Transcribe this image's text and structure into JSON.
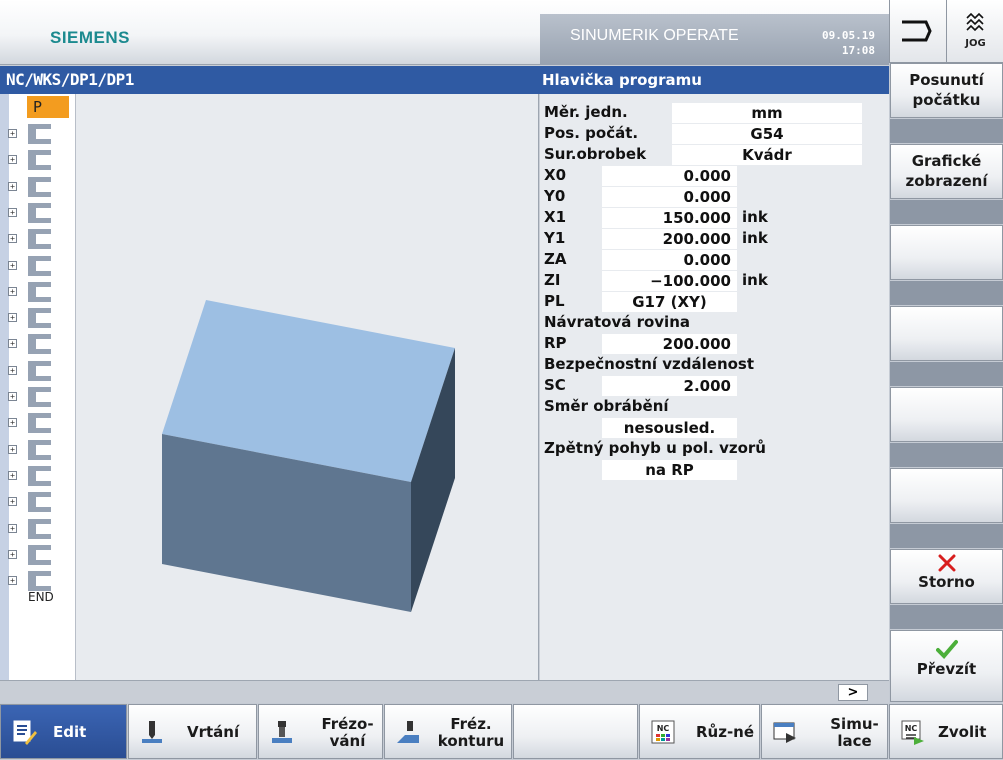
{
  "header": {
    "logo": "SIEMENS",
    "app_title": "SINUMERIK OPERATE",
    "date": "09.05.19",
    "time": "17:08",
    "mode": "JOG"
  },
  "pathbar": {
    "path": "NC/WKS/DP1/DP1",
    "panel_title": "Hlavička programu"
  },
  "tree": {
    "first": "P",
    "end": "END"
  },
  "form": {
    "unit_label": "Měr. jedn.",
    "unit_value": "mm",
    "origin_label": "Pos. počát.",
    "origin_value": "G54",
    "blank_label": "Sur.obrobek",
    "blank_value": "Kvádr",
    "x0_label": "X0",
    "x0_value": "0.000",
    "y0_label": "Y0",
    "y0_value": "0.000",
    "x1_label": "X1",
    "x1_value": "150.000",
    "x1_unit": "ink",
    "y1_label": "Y1",
    "y1_value": "200.000",
    "y1_unit": "ink",
    "za_label": "ZA",
    "za_value": "0.000",
    "zi_label": "ZI",
    "zi_value": "−100.000",
    "zi_unit": "ink",
    "pl_label": "PL",
    "pl_value": "G17 (XY)",
    "retract_label": "Návratová rovina",
    "rp_label": "RP",
    "rp_value": "200.000",
    "safety_label": "Bezpečnostní vzdálenost",
    "sc_label": "SC",
    "sc_value": "2.000",
    "dir_label": "Směr obrábění",
    "dir_value": "nesousled.",
    "retpos_label": "Zpětný pohyb u pol. vzorů",
    "retpos_value": "na RP"
  },
  "scroll": {
    "arrow": ">"
  },
  "softkeys": {
    "sk1": "Posunutí počátku",
    "sk2": "Grafické zobrazení",
    "cancel": "Storno",
    "accept": "Převzít"
  },
  "bottom": {
    "edit": "Edit",
    "drill": "Vrtání",
    "mill": "Frézo-vání",
    "contour": "Fréz. konturu",
    "misc": "Růz-né",
    "sim": "Simu-lace",
    "select": "Zvolit",
    "nc_badge": "NC"
  },
  "colors": {
    "accent": "#2f5aa3",
    "active_tree": "#f39c1f",
    "cancel": "#d81e1e",
    "accept": "#4caf3a",
    "block_top": "#9dbfe3",
    "block_front": "#5f7690",
    "block_side": "#35475a"
  }
}
